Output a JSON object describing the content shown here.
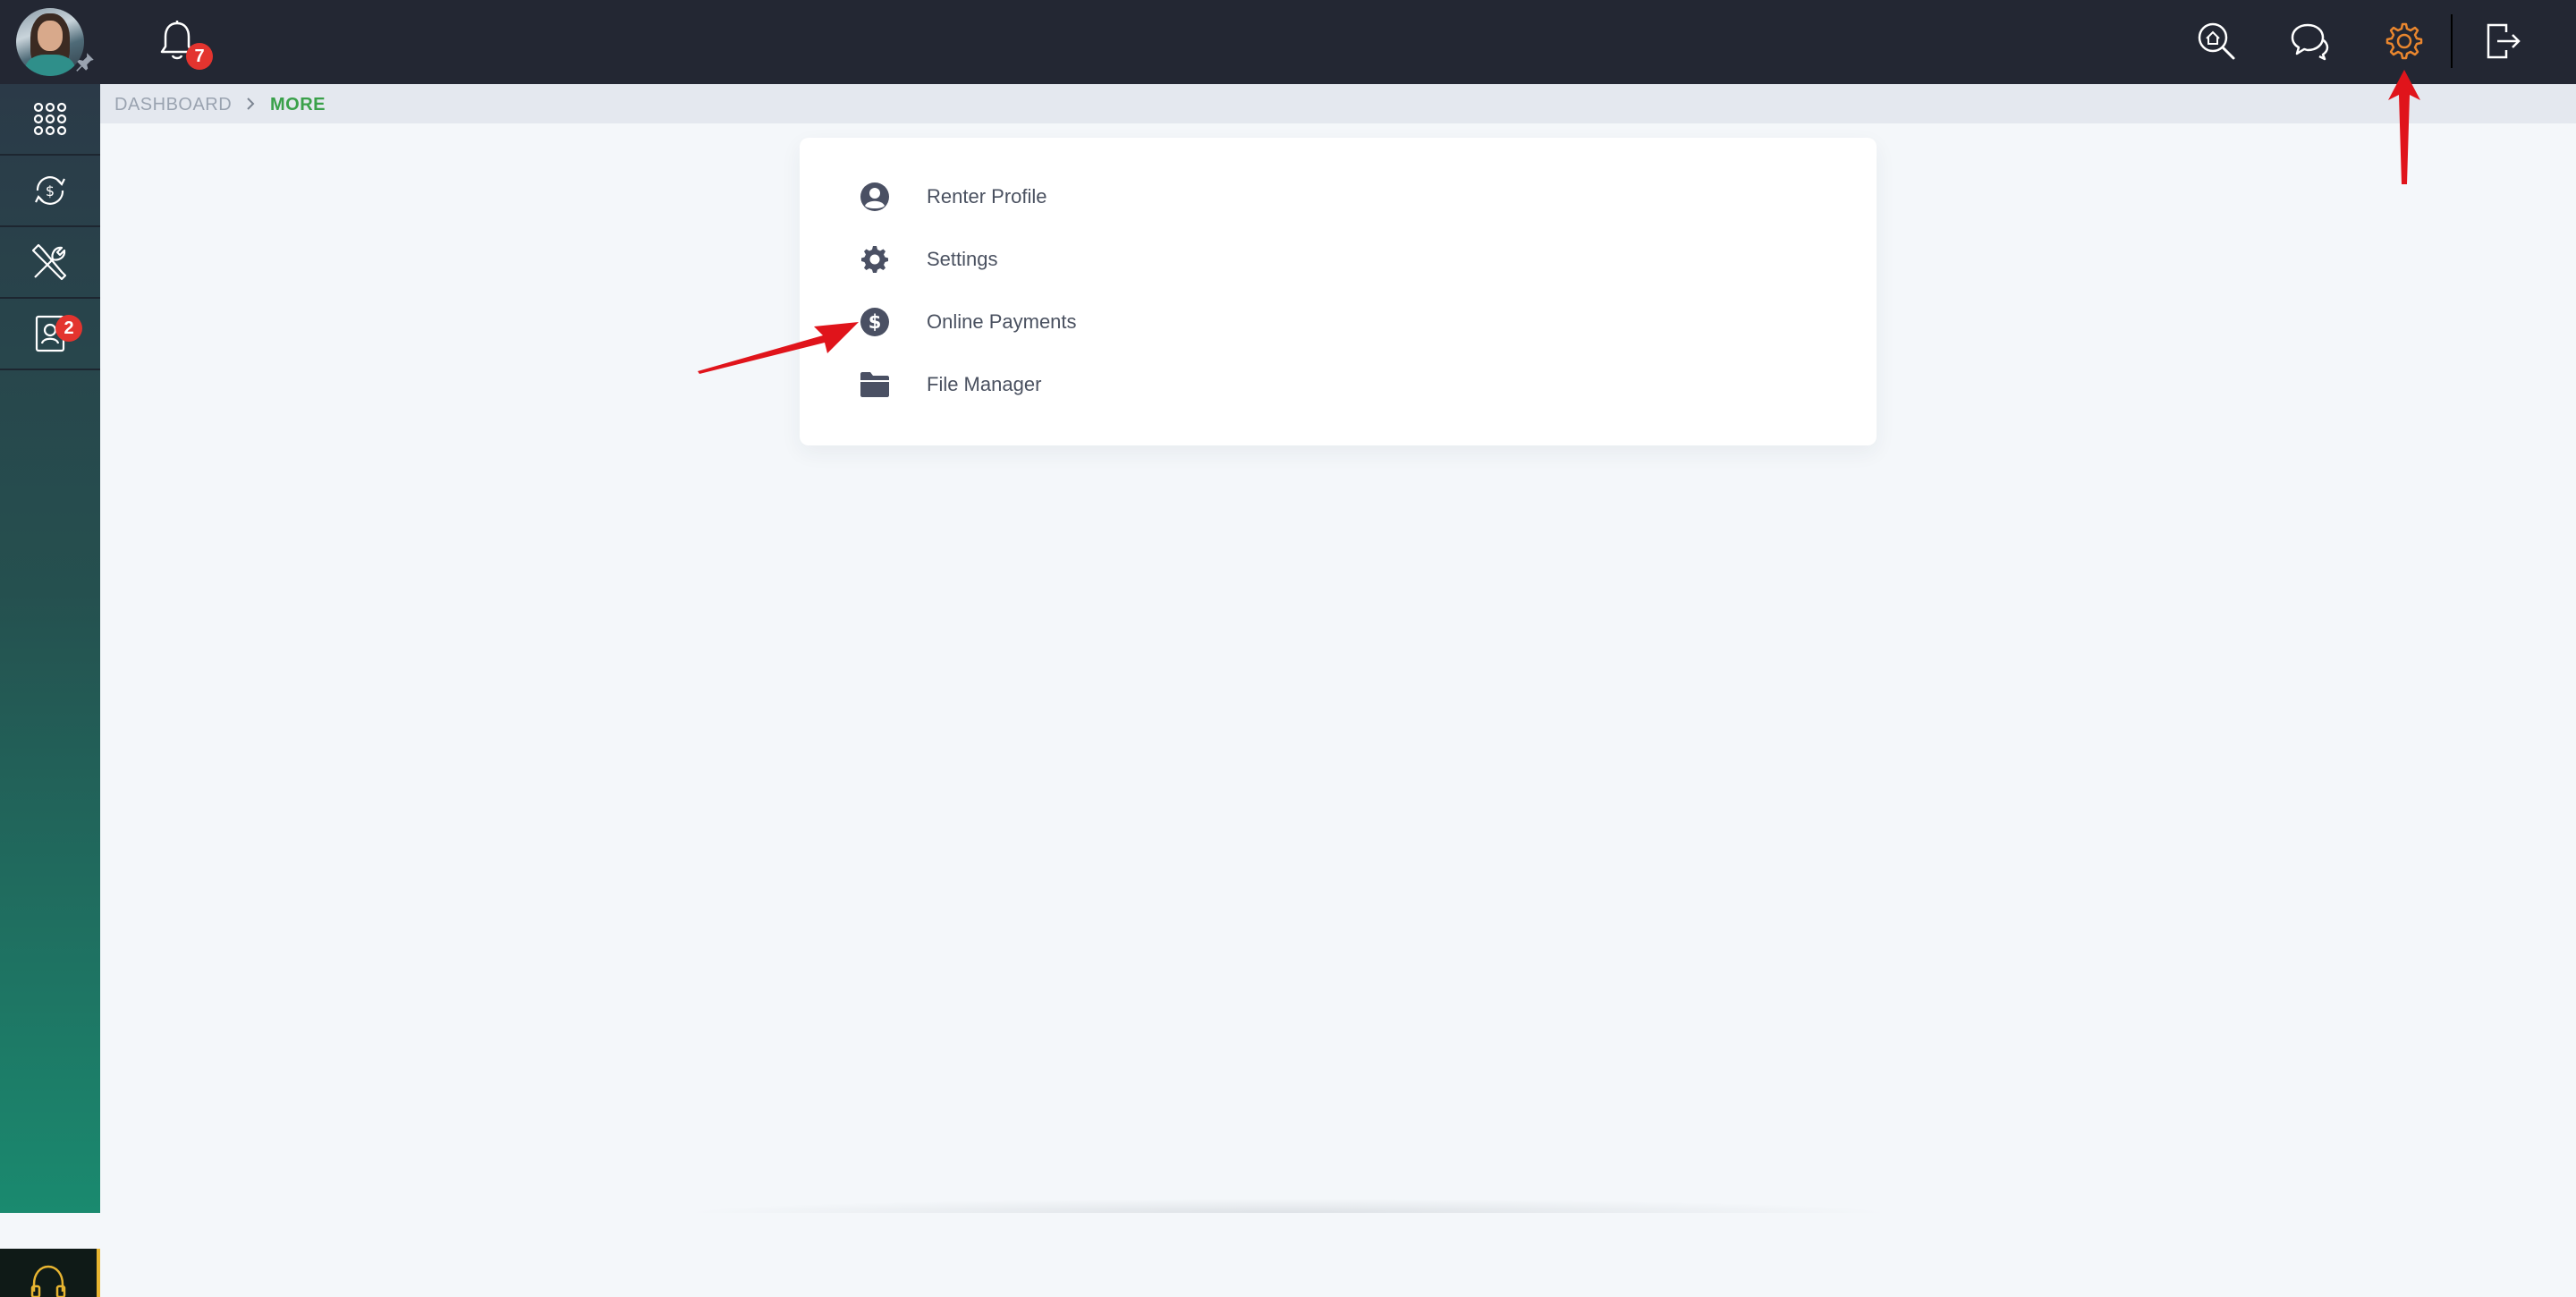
{
  "topbar": {
    "notification_count": "7",
    "icons": [
      "home-search-icon",
      "chat-icon",
      "gear-icon",
      "logout-icon"
    ],
    "active_icon_color": "#e9862e"
  },
  "sidebar": {
    "items": [
      {
        "icon": "grid-icon"
      },
      {
        "icon": "payments-cycle-icon"
      },
      {
        "icon": "tools-icon"
      },
      {
        "icon": "contact-card-icon",
        "badge": "2"
      }
    ],
    "support_icon": "headset-icon"
  },
  "breadcrumb": {
    "items": [
      "DASHBOARD",
      "MORE"
    ]
  },
  "menu": {
    "items": [
      {
        "label": "Renter Profile",
        "icon": "user-circle-icon"
      },
      {
        "label": "Settings",
        "icon": "gear-icon"
      },
      {
        "label": "Online Payments",
        "icon": "dollar-circle-icon"
      },
      {
        "label": "File Manager",
        "icon": "folder-icon"
      }
    ]
  },
  "colors": {
    "topbar": "#232733",
    "accent_green": "#3aa14a",
    "badge_red": "#e3342f",
    "annotation_red": "#e0141b"
  }
}
